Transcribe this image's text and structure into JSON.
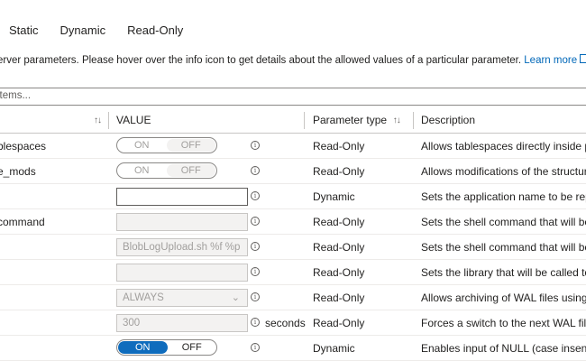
{
  "tabs": [
    "Static",
    "Dynamic",
    "Read-Only"
  ],
  "description": {
    "text": "erver parameters. Please hover over the info icon to get details about the allowed values of a particular parameter.",
    "link": "Learn more"
  },
  "filter": {
    "placeholder": "items..."
  },
  "columns": {
    "name": "",
    "value": "VALUE",
    "type": "Parameter type",
    "description": "Description"
  },
  "toggle_labels": {
    "on": "ON",
    "off": "OFF"
  },
  "rows": [
    {
      "name": "blespaces",
      "value_kind": "toggle-off",
      "type": "Read-Only",
      "desc": "Allows tablespaces directly inside pg_"
    },
    {
      "name": "e_mods",
      "value_kind": "toggle-off",
      "type": "Read-Only",
      "desc": "Allows modifications of the structure"
    },
    {
      "name": "",
      "value_kind": "text",
      "value": "",
      "type": "Dynamic",
      "desc": "Sets the application name to be repo"
    },
    {
      "name": "command",
      "value_kind": "text-disabled",
      "value": "",
      "type": "Read-Only",
      "desc": "Sets the shell command that will be e"
    },
    {
      "name": "",
      "value_kind": "text-disabled",
      "value": "BlobLogUpload.sh %f %p",
      "type": "Read-Only",
      "desc": "Sets the shell command that will be c"
    },
    {
      "name": "",
      "value_kind": "text-disabled",
      "value": "",
      "type": "Read-Only",
      "desc": "Sets the library that will be called to a"
    },
    {
      "name": "",
      "value_kind": "dropdown-disabled",
      "value": "ALWAYS",
      "type": "Read-Only",
      "desc": "Allows archiving of WAL files using ar"
    },
    {
      "name": "",
      "value_kind": "text-disabled",
      "value": "300",
      "unit": "seconds",
      "type": "Read-Only",
      "desc": "Forces a switch to the next WAL file if"
    },
    {
      "name": "",
      "value_kind": "toggle-on",
      "type": "Dynamic",
      "desc": "Enables input of NULL (case insensitiv"
    }
  ],
  "colors": {
    "accent": "#0f6cbd",
    "link": "#0067b8",
    "border": "#8a8886"
  }
}
